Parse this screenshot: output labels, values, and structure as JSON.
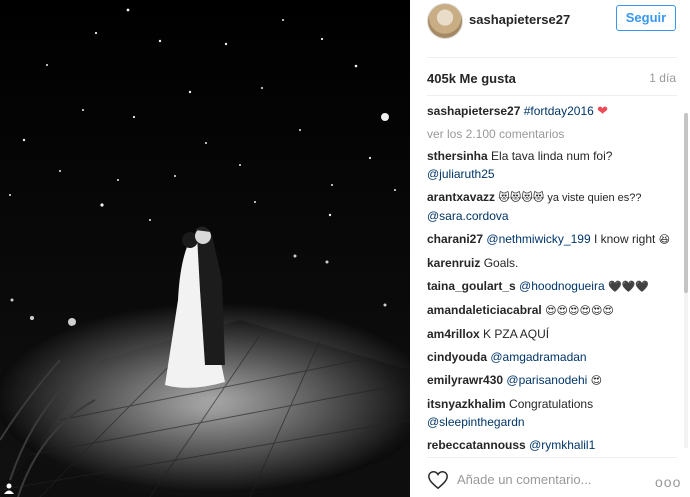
{
  "author": {
    "username": "sashapieterse27",
    "follow_label": "Seguir"
  },
  "likes": "405k Me gusta",
  "time_ago": "1 día",
  "caption": {
    "user": "sashapieterse27",
    "hashtag": "#fortday2016",
    "emoji": "❤"
  },
  "view_all": "ver los 2.100 comentarios",
  "comments": [
    {
      "user": "sthersinha",
      "text": "Ela tava linda num foi?",
      "mention": "@juliaruth25",
      "emoji": ""
    },
    {
      "user": "arantxavazz",
      "text": "😻😻😻😻 ya viste quien es??",
      "mention": "@sara.cordova",
      "emoji": ""
    },
    {
      "user": "charani27",
      "text": "",
      "mention": "@nethmiwicky_199",
      "after": "I know right",
      "emoji": "😆"
    },
    {
      "user": "karenruiz",
      "text": "Goals.",
      "mention": "",
      "emoji": ""
    },
    {
      "user": "taina_goulart_s",
      "text": "",
      "mention": "@hoodnogueira",
      "emoji": "🖤🖤🖤"
    },
    {
      "user": "amandaleticiacabral",
      "text": "",
      "mention": "",
      "emoji": "😍😍😍😍😍😍"
    },
    {
      "user": "am4rillox",
      "text": "K PZA AQUÍ",
      "mention": "",
      "emoji": ""
    },
    {
      "user": "cindyouda",
      "text": "",
      "mention": "@amgadramadan",
      "emoji": ""
    },
    {
      "user": "emilyrawr430",
      "text": "",
      "mention": "@parisanodehi",
      "emoji": "😍"
    },
    {
      "user": "itsnyazkhalim",
      "text": "Congratulations",
      "mention": "@sleepinthegardn",
      "emoji": ""
    },
    {
      "user": "rebeccatannouss",
      "text": "",
      "mention": "@rymkhalil1",
      "emoji": ""
    }
  ],
  "add_comment_placeholder": "Añade un comentario...",
  "more_label": "ooo",
  "icons": {
    "like": "heart-outline-icon",
    "more": "more-options-icon",
    "photo_tag": "user-tag-icon"
  },
  "colors": {
    "follow": "#3897f0",
    "mention": "#003569",
    "heart": "#ed4956"
  }
}
